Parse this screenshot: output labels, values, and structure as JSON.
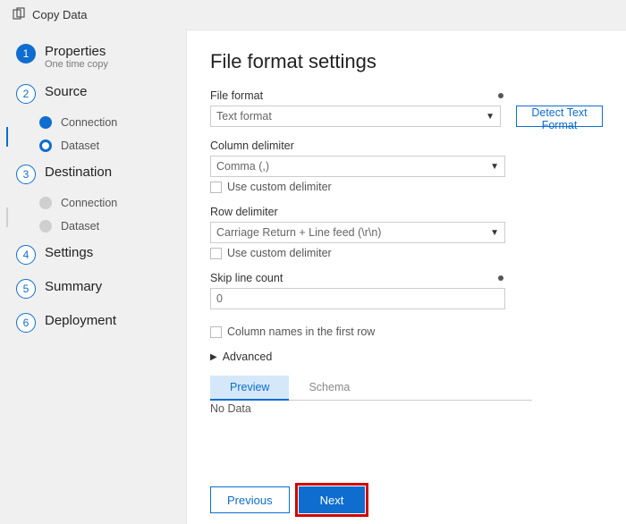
{
  "title": "Copy Data",
  "sidebar": {
    "steps": [
      {
        "num": "1",
        "label": "Properties",
        "sub": "One time copy"
      },
      {
        "num": "2",
        "label": "Source",
        "children": [
          {
            "label": "Connection"
          },
          {
            "label": "Dataset"
          }
        ]
      },
      {
        "num": "3",
        "label": "Destination",
        "children": [
          {
            "label": "Connection"
          },
          {
            "label": "Dataset"
          }
        ]
      },
      {
        "num": "4",
        "label": "Settings"
      },
      {
        "num": "5",
        "label": "Summary"
      },
      {
        "num": "6",
        "label": "Deployment"
      }
    ]
  },
  "main": {
    "heading": "File format settings",
    "fileFormat": {
      "label": "File format",
      "value": "Text format"
    },
    "detectBtn": "Detect Text Format",
    "colDelim": {
      "label": "Column delimiter",
      "value": "Comma (,)",
      "customLabel": "Use custom delimiter"
    },
    "rowDelim": {
      "label": "Row delimiter",
      "value": "Carriage Return + Line feed (\\r\\n)",
      "customLabel": "Use custom delimiter"
    },
    "skip": {
      "label": "Skip line count",
      "value": "0"
    },
    "colNames": "Column names in the first row",
    "advanced": "Advanced",
    "tabs": {
      "preview": "Preview",
      "schema": "Schema"
    },
    "noData": "No Data"
  },
  "footer": {
    "prev": "Previous",
    "next": "Next"
  }
}
